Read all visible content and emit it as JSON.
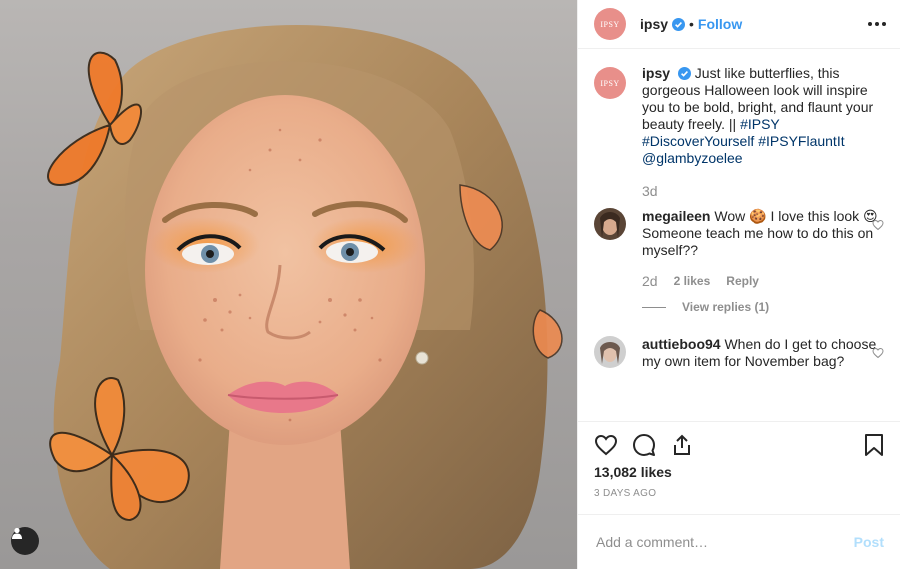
{
  "header": {
    "avatar_text": "IPSY",
    "username": "ipsy",
    "separator": "•",
    "follow_label": "Follow"
  },
  "caption": {
    "avatar_text": "IPSY",
    "username": "ipsy",
    "text": "Just like butterflies, this gorgeous Halloween look will inspire you to be bold, bright, and flaunt your beauty freely. || ",
    "hashtags": [
      "#IPSY",
      "#DiscoverYourself",
      "#IPSYFlauntIt",
      "@glambyzoelee"
    ],
    "age": "3d"
  },
  "comments": [
    {
      "username": "megaileen",
      "text_a": "Wow 🍪  I love this look",
      "text_b": "😍  Someone teach me how to do this on myself??",
      "age": "2d",
      "likes": "2 likes",
      "reply_label": "Reply",
      "view_replies": "View replies (1)"
    },
    {
      "username": "auttieboo94",
      "text": "When do I get to choose my own item for November bag?"
    }
  ],
  "actions": {
    "likes": "13,082 likes",
    "date": "3 DAYS AGO"
  },
  "composer": {
    "placeholder": "Add a comment…",
    "post_label": "Post"
  },
  "colors": {
    "accent": "#3897f0",
    "hashtag": "#003569",
    "brand_avatar": "#e88f8a"
  },
  "icons": [
    "verified-icon",
    "more-icon",
    "heart-icon",
    "comment-icon",
    "share-icon",
    "bookmark-icon",
    "user-tag-icon"
  ]
}
